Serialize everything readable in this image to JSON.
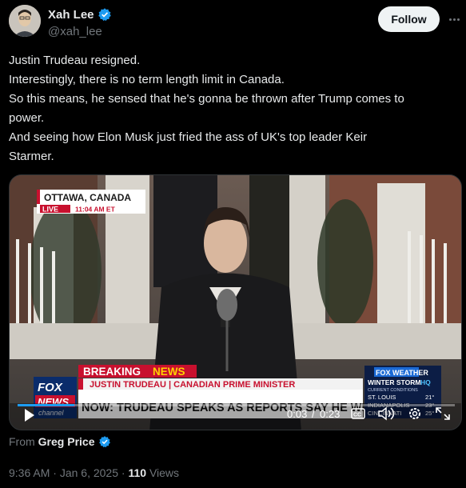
{
  "author": {
    "display_name": "Xah Lee",
    "handle": "@xah_lee",
    "verified_icon": "verified-badge-icon"
  },
  "follow_label": "Follow",
  "tweet_lines": [
    "Justin Trudeau resigned.",
    "Interestingly, there is no term length limit in Canada.",
    "So this means, he sensed that he's gonna be thrown after Trump comes to",
    "power.",
    "And seeing how Elon Musk just fried the ass of UK's top leader Keir",
    "Starmer."
  ],
  "video": {
    "location": "OTTAWA, CANADA",
    "live_label": "LIVE",
    "live_time": "11:04 AM ET",
    "breaking_label": "BREAKING",
    "news_label": "NEWS",
    "speaker_label": "JUSTIN TRUDEAU | CANADIAN PRIME MINISTER",
    "headline": "NOW: TRUDEAU SPEAKS AS REPORTS SAY HE WILL RESIGN",
    "fox_logo_line1": "FOX",
    "fox_logo_line2": "NEWS",
    "fox_logo_line3": "channel",
    "weather_brand": "FOX WEATHER",
    "weather_title": "WINTER STORM",
    "weather_hq": "HQ",
    "weather_sub": "CURRENT CONDITIONS",
    "weather_rows": [
      {
        "city": "ST. LOUIS",
        "temp": "21°"
      },
      {
        "city": "INDIANAPOLIS",
        "temp": "23°"
      },
      {
        "city": "CINCINNATI",
        "temp": "25°"
      }
    ],
    "current_time": "0:03",
    "separator": "/",
    "duration": "0:23",
    "progress": 0.13,
    "controls": {
      "play": "play-icon",
      "captions": "captions-icon",
      "volume": "volume-icon",
      "settings": "settings-gear-icon",
      "fullscreen": "fullscreen-icon"
    },
    "captions_label": "CC"
  },
  "from": {
    "prefix": "From",
    "source": "Greg Price"
  },
  "meta": {
    "time": "9:36 AM",
    "dot1": "·",
    "date": "Jan 6, 2025",
    "dot2": "·",
    "views_count": "110",
    "views_label": "Views"
  },
  "colors": {
    "background": "#000000",
    "text": "#e7e9ea",
    "muted": "#71767b",
    "verified": "#1d9bf0",
    "fox_red": "#c8102e"
  }
}
